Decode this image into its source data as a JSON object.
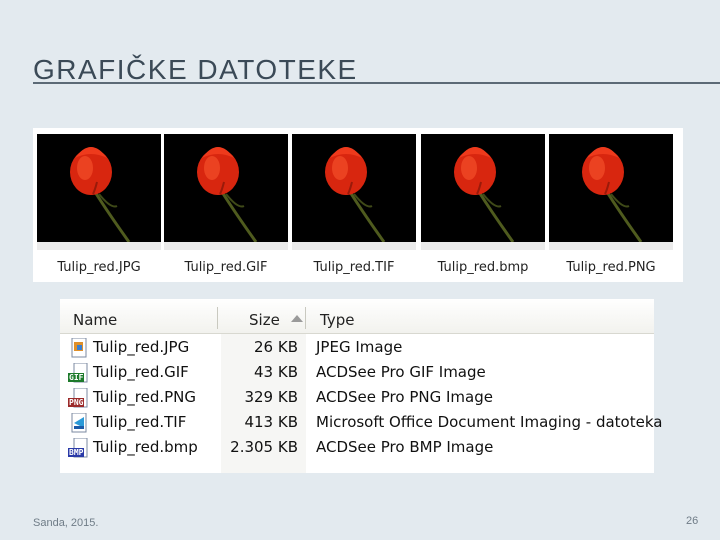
{
  "slide": {
    "title": "GRAFIČKE DATOTEKE",
    "footer_left": "Sanda, 2015.",
    "page_number": "26"
  },
  "thumbnails": [
    {
      "label": "Tulip_red.JPG",
      "image": "red-tulip-photo"
    },
    {
      "label": "Tulip_red.GIF",
      "image": "red-tulip-photo"
    },
    {
      "label": "Tulip_red.TIF",
      "image": "red-tulip-photo"
    },
    {
      "label": "Tulip_red.bmp",
      "image": "red-tulip-photo"
    },
    {
      "label": "Tulip_red.PNG",
      "image": "red-tulip-photo"
    }
  ],
  "explorer": {
    "columns": {
      "name": "Name",
      "size": "Size",
      "type": "Type"
    },
    "sort_column": "Size",
    "files": [
      {
        "name": "Tulip_red.JPG",
        "size": "26 KB",
        "type": "JPEG Image",
        "icon": "jpeg-file-icon",
        "badge": ""
      },
      {
        "name": "Tulip_red.GIF",
        "size": "43 KB",
        "type": "ACDSee Pro GIF Image",
        "icon": "gif-file-icon",
        "badge": "GIF"
      },
      {
        "name": "Tulip_red.PNG",
        "size": "329 KB",
        "type": "ACDSee Pro PNG Image",
        "icon": "png-file-icon",
        "badge": "PNG"
      },
      {
        "name": "Tulip_red.TIF",
        "size": "413 KB",
        "type": "Microsoft Office Document Imaging - datoteka",
        "icon": "tif-file-icon",
        "badge": ""
      },
      {
        "name": "Tulip_red.bmp",
        "size": "2.305 KB",
        "type": "ACDSee Pro BMP Image",
        "icon": "bmp-file-icon",
        "badge": "BMP"
      }
    ]
  },
  "colors": {
    "background": "#e3eaef",
    "title": "#3b4a57",
    "tulip": "#d8260f",
    "gif_badge": "#1d7a2b",
    "png_badge": "#9b2a2a",
    "bmp_badge": "#2a3aa8"
  }
}
